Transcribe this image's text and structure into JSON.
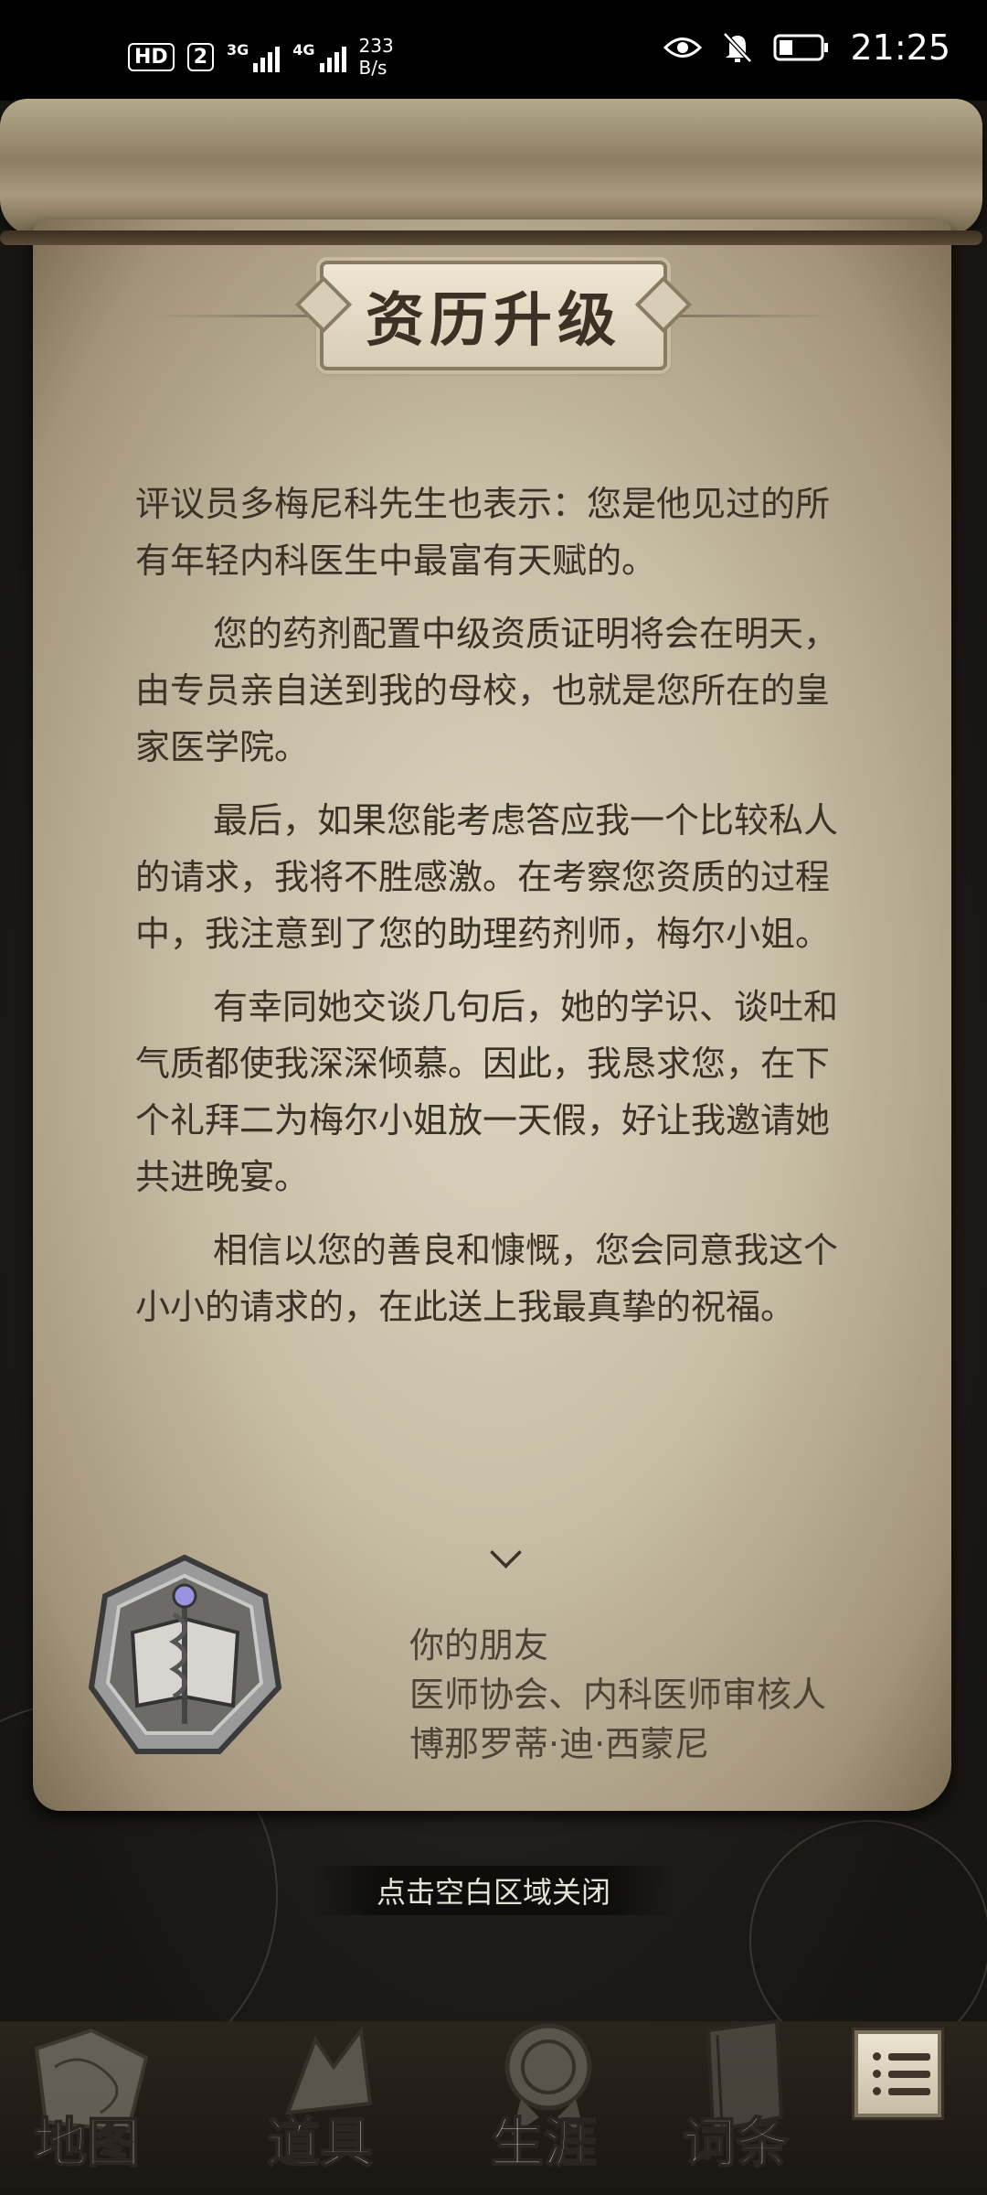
{
  "status_bar": {
    "hd_badge": "HD",
    "sim_badge": "2",
    "net1": "3G",
    "net2": "4G",
    "speed_value": "233",
    "speed_unit": "B/s",
    "time": "21:25",
    "icons": [
      "eye-icon",
      "bell-muted-icon",
      "battery-icon"
    ]
  },
  "dialog": {
    "title": "资历升级",
    "paragraphs": [
      "评议员多梅尼科先生也表示：您是他见过的所有年轻内科医生中最富有天赋的。",
      "您的药剂配置中级资质证明将会在明天，由专员亲自送到我的母校，也就是您所在的皇家医学院。",
      "最后，如果您能考虑答应我一个比较私人的请求，我将不胜感激。在考察您资质的过程中，我注意到了您的助理药剂师，梅尔小姐。",
      "有幸同她交谈几句后，她的学识、谈吐和气质都使我深深倾慕。因此，我恳求您，在下个礼拜二为梅尔小姐放一天假，好让我邀请她共进晚宴。",
      "相信以您的善良和慷慨，您会同意我这个小小的请求的，在此送上我最真挚的祝福。"
    ],
    "signature": {
      "line1": "你的朋友",
      "line2": "医师协会、内科医师审核人",
      "line3": "博那罗蒂·迪·西蒙尼"
    },
    "close_hint": "点击空白区域关闭"
  },
  "bottom_nav": {
    "items": [
      {
        "label": "地图",
        "icon": "map-icon"
      },
      {
        "label": "道具",
        "icon": "items-icon"
      },
      {
        "label": "生涯",
        "icon": "career-medal-icon"
      },
      {
        "label": "词条",
        "icon": "book-icon"
      }
    ],
    "menu_icon": "list-menu-icon"
  }
}
